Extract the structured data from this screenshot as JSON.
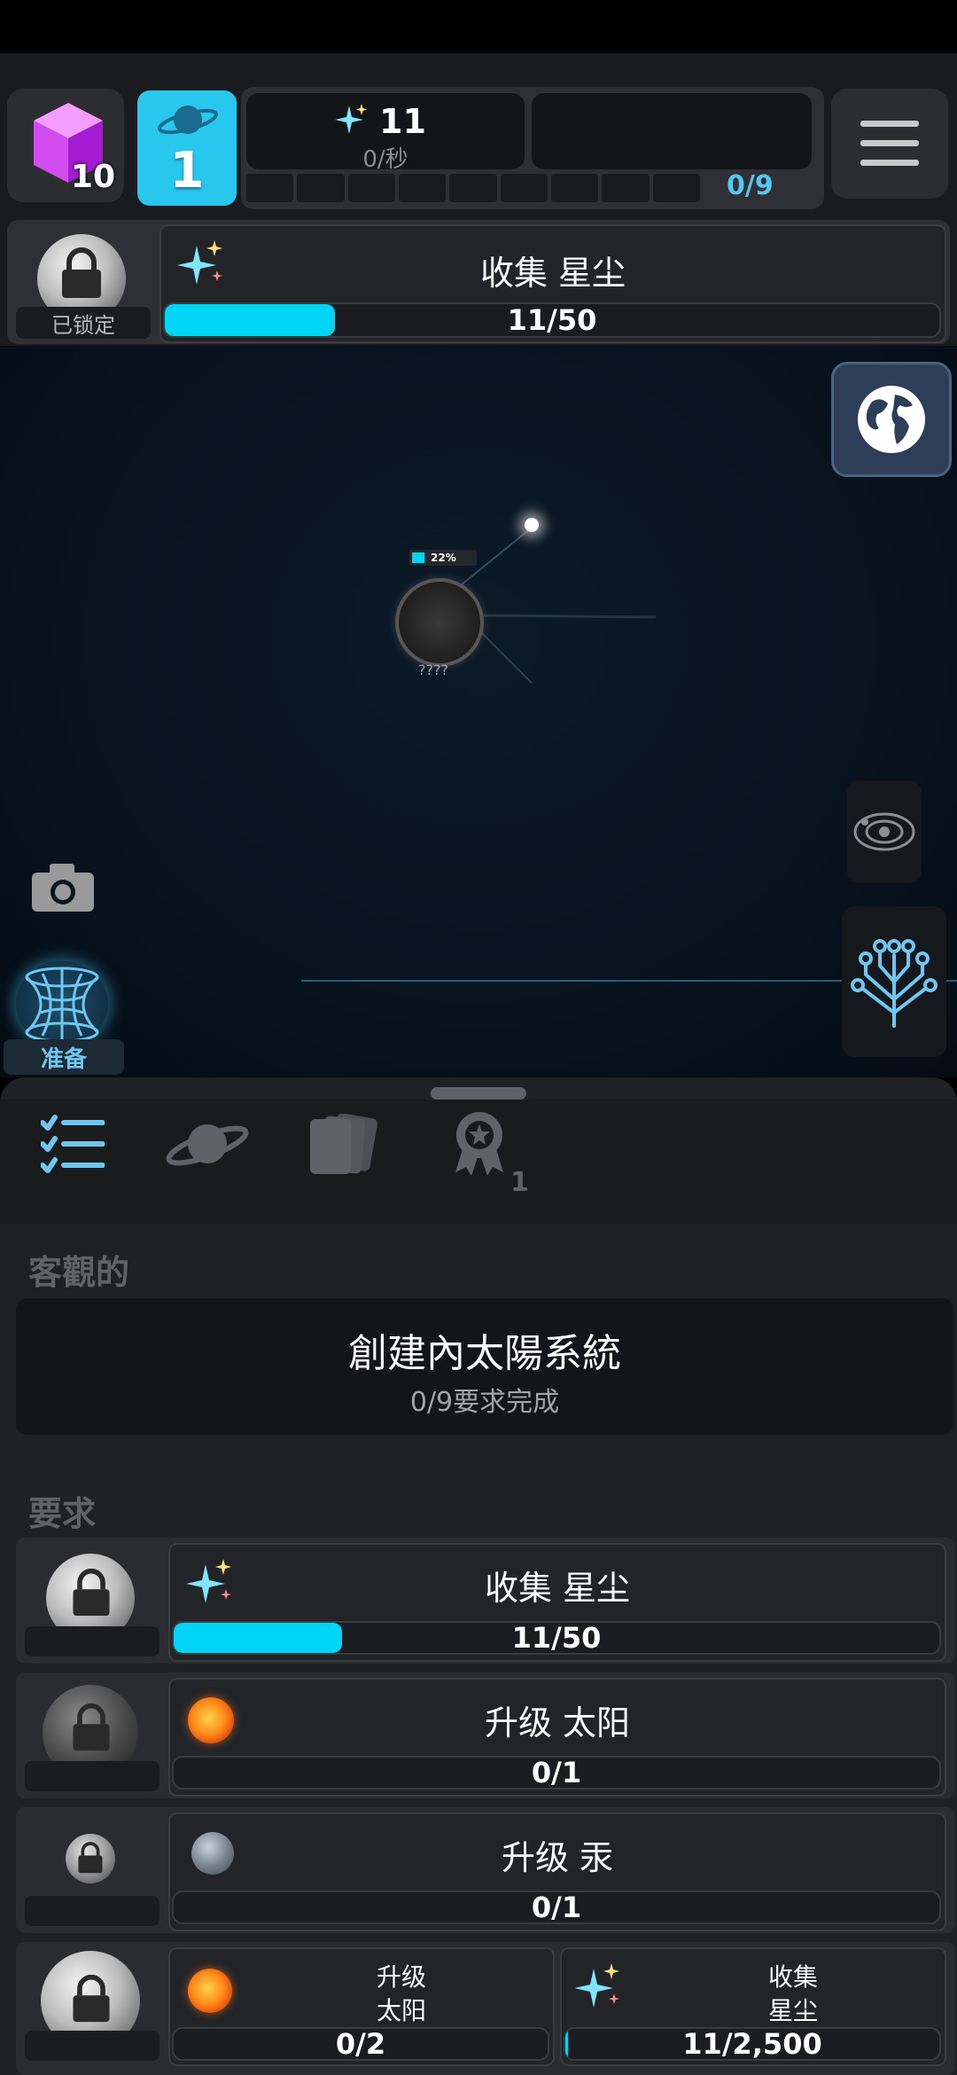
{
  "hud": {
    "cubes": "10",
    "level": "1",
    "stardust_count": "11",
    "stardust_rate": "0/秒",
    "progress_count": "0/9"
  },
  "top_task": {
    "locked_label": "已锁定",
    "title": "收集 星尘",
    "progress_text": "11/50",
    "progress": 0.22
  },
  "scene": {
    "planet_percent": "22%",
    "planet_label": "????",
    "ready_label": "准备"
  },
  "tabs": {
    "achievements_badge": "1"
  },
  "objective": {
    "section_title": "客觀的",
    "title": "創建內太陽系統",
    "subtitle": "0/9要求完成"
  },
  "requirements": {
    "section_title": "要求",
    "items": [
      {
        "title": "收集 星尘",
        "progress_text": "11/50",
        "progress": 0.22
      },
      {
        "title": "升级 太阳",
        "progress_text": "0/1",
        "progress": 0
      },
      {
        "title": "升级 汞",
        "progress_text": "0/1",
        "progress": 0
      }
    ],
    "split": {
      "left_line1": "升级",
      "left_line2": "太阳",
      "left_progress": "0/2",
      "right_line1": "收集",
      "right_line2": "星尘",
      "right_progress": "11/2,500"
    }
  },
  "colors": {
    "accent": "#00d5f5",
    "panel": "#2b2d31",
    "space": "#0a1420"
  }
}
